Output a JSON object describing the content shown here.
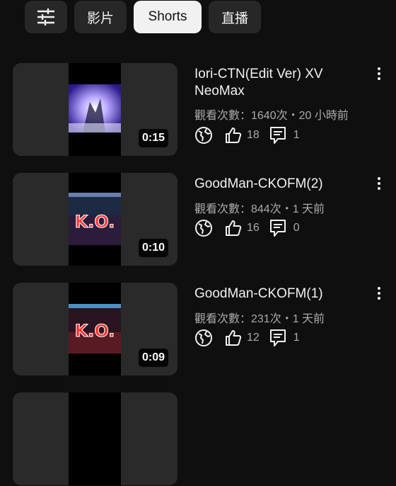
{
  "filters": {
    "chips": [
      "影片",
      "Shorts",
      "直播"
    ],
    "icon": "sliders-icon"
  },
  "videos": [
    {
      "title": "Iori-CTN(Edit Ver) XV NeoMax",
      "meta": "觀看次數：1640次・20 小時前",
      "duration": "0:15",
      "likes": "18",
      "comments": "1"
    },
    {
      "title": "GoodMan-CKOFM(2)",
      "meta": "觀看次數：844次・1 天前",
      "duration": "0:10",
      "likes": "16",
      "comments": "0",
      "overlay": "K.O."
    },
    {
      "title": "GoodMan-CKOFM(1)",
      "meta": "觀看次數：231次・1 天前",
      "duration": "0:09",
      "likes": "12",
      "comments": "1",
      "overlay": "K.O."
    }
  ],
  "icons": {
    "visibility": "globe-icon",
    "like": "thumbs-up-icon",
    "comment": "comment-icon",
    "more": "more-vert-icon"
  },
  "colors": {
    "background": "#0f0f0f",
    "chip": "#272727",
    "chip_active": "#f1f1f1",
    "secondary_text": "#aaaaaa"
  }
}
